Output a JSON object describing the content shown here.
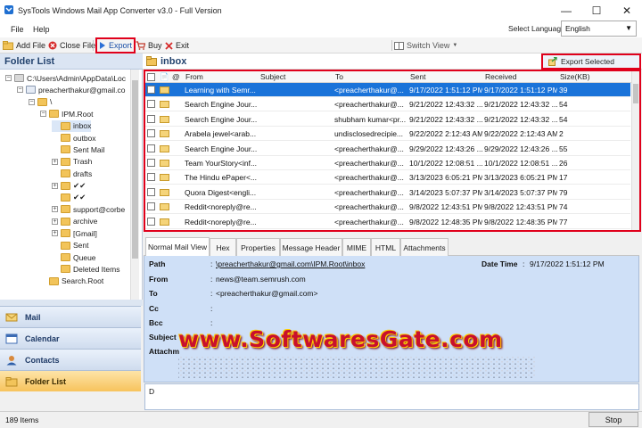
{
  "window": {
    "title": "SysTools Windows Mail App Converter v3.0 - Full Version",
    "controls": [
      "—",
      "☐",
      "✕"
    ]
  },
  "menu": {
    "items": [
      "File",
      "Help"
    ],
    "language_label": "Select Language:",
    "language_value": "English"
  },
  "toolbar": {
    "add_file": "Add File",
    "close_file": "Close File",
    "export": "Export",
    "buy": "Buy",
    "exit": "Exit",
    "switch_view": "Switch View"
  },
  "folder_panel": {
    "header": "Folder List",
    "tree": [
      {
        "label": "C:\\Users\\Admin\\AppData\\Loc",
        "expander": "−"
      },
      {
        "label": "preacherthakur@gmail.co",
        "expander": "−"
      },
      {
        "label": "\\",
        "expander": "−"
      },
      {
        "label": "IPM.Root",
        "expander": "−"
      },
      {
        "label": "inbox",
        "expander": ""
      },
      {
        "label": "outbox",
        "expander": ""
      },
      {
        "label": "Sent Mail",
        "expander": ""
      },
      {
        "label": "Trash",
        "expander": "+"
      },
      {
        "label": "drafts",
        "expander": ""
      },
      {
        "label": "✔✔",
        "expander": "+"
      },
      {
        "label": "✔✔",
        "expander": ""
      },
      {
        "label": "support@corbe",
        "expander": "+"
      },
      {
        "label": "archive",
        "expander": "+"
      },
      {
        "label": "[Gmail]",
        "expander": "+"
      },
      {
        "label": "Sent",
        "expander": ""
      },
      {
        "label": "Queue",
        "expander": ""
      },
      {
        "label": "Deleted Items",
        "expander": ""
      },
      {
        "label": "Search.Root",
        "expander": ""
      }
    ]
  },
  "nav": {
    "mail": "Mail",
    "calendar": "Calendar",
    "contacts": "Contacts",
    "folder_list": "Folder List"
  },
  "status": {
    "items": "189 Items",
    "stop": "Stop"
  },
  "list": {
    "folder_title": "inbox",
    "export_selected": "Export Selected",
    "columns": [
      "From",
      "Subject",
      "To",
      "Sent",
      "Received",
      "Size(KB)"
    ],
    "rows": [
      {
        "from": "Learning with Semr...",
        "subject": "",
        "to": "<preacherthakur@...",
        "sent": "9/17/2022 1:51:12 PM",
        "received": "9/17/2022 1:51:12 PM",
        "size": "39"
      },
      {
        "from": "Search Engine Jour...",
        "subject": "",
        "to": "<preacherthakur@...",
        "sent": "9/21/2022 12:43:32 ...",
        "received": "9/21/2022 12:43:32 ...",
        "size": "54"
      },
      {
        "from": "Search Engine Jour...",
        "subject": "",
        "to": "shubham kumar<pr...",
        "sent": "9/21/2022 12:43:32 ...",
        "received": "9/21/2022 12:43:32 ...",
        "size": "54"
      },
      {
        "from": "Arabela jewel<arab...",
        "subject": "",
        "to": "undisclosedrecipie...",
        "sent": "9/22/2022 2:12:43 AM",
        "received": "9/22/2022 2:12:43 AM",
        "size": "2"
      },
      {
        "from": "Search Engine Jour...",
        "subject": "",
        "to": "<preacherthakur@...",
        "sent": "9/29/2022 12:43:26 ...",
        "received": "9/29/2022 12:43:26 ...",
        "size": "55"
      },
      {
        "from": "Team YourStory<inf...",
        "subject": "",
        "to": "<preacherthakur@...",
        "sent": "10/1/2022 12:08:51 ...",
        "received": "10/1/2022 12:08:51 ...",
        "size": "26"
      },
      {
        "from": "The Hindu ePaper<...",
        "subject": "",
        "to": "<preacherthakur@...",
        "sent": "3/13/2023 6:05:21 PM",
        "received": "3/13/2023 6:05:21 PM",
        "size": "17"
      },
      {
        "from": "Quora Digest<engli...",
        "subject": "",
        "to": "<preacherthakur@...",
        "sent": "3/14/2023 5:07:37 PM",
        "received": "3/14/2023 5:07:37 PM",
        "size": "79"
      },
      {
        "from": "Reddit<noreply@re...",
        "subject": "",
        "to": "<preacherthakur@...",
        "sent": "9/8/2022 12:43:51 PM",
        "received": "9/8/2022 12:43:51 PM",
        "size": "74"
      },
      {
        "from": "Reddit<noreply@re...",
        "subject": "",
        "to": "<preacherthakur@...",
        "sent": "9/8/2022 12:48:35 PM",
        "received": "9/8/2022 12:48:35 PM",
        "size": "77"
      }
    ]
  },
  "tabs": [
    "Normal Mail View",
    "Hex",
    "Properties",
    "Message Header",
    "MIME",
    "HTML",
    "Attachments"
  ],
  "preview": {
    "labels": {
      "path": "Path",
      "from": "From",
      "to": "To",
      "cc": "Cc",
      "bcc": "Bcc",
      "subject": "Subject",
      "attachments": "Attachm",
      "date_time": "Date Time"
    },
    "path": "\\preacherthakur@gmail.com\\IPM.Root\\inbox",
    "from": "news@team.semrush.com",
    "to": "<preacherthakur@gmail.com>",
    "cc": "",
    "bcc": "",
    "date_time": "9/17/2022 1:51:12 PM",
    "body": "D"
  },
  "watermark": "www.SoftwaresGate.com"
}
